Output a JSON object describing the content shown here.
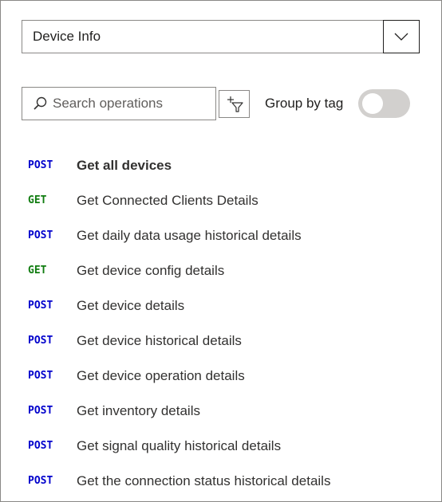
{
  "api_select": {
    "value": "Device Info"
  },
  "search": {
    "placeholder": "Search operations"
  },
  "group_by_tag": {
    "label": "Group by tag",
    "enabled": false
  },
  "colors": {
    "post": "#0000cc",
    "get": "#107c10",
    "toggle_off": "#d2d0ce"
  },
  "operations": [
    {
      "method": "POST",
      "name": "Get all devices",
      "selected": true
    },
    {
      "method": "GET",
      "name": "Get Connected Clients Details"
    },
    {
      "method": "POST",
      "name": "Get daily data usage historical details"
    },
    {
      "method": "GET",
      "name": "Get device config details"
    },
    {
      "method": "POST",
      "name": "Get device details"
    },
    {
      "method": "POST",
      "name": "Get device historical details"
    },
    {
      "method": "POST",
      "name": "Get device operation details"
    },
    {
      "method": "POST",
      "name": "Get inventory details"
    },
    {
      "method": "POST",
      "name": "Get signal quality historical details"
    },
    {
      "method": "POST",
      "name": "Get the connection status historical details"
    }
  ]
}
